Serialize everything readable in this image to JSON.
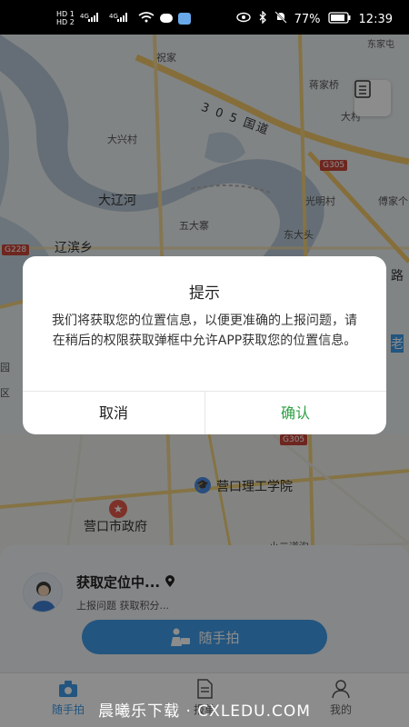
{
  "status_bar": {
    "sim1": "HD 1",
    "sim2": "HD 2",
    "net1": "4G",
    "net2": "4G",
    "battery": "77%",
    "time": "12:39"
  },
  "map": {
    "labels": {
      "zhuangjia": "祝家",
      "road305": "3 0 5 国道",
      "jiangjia": "蒋家桥",
      "daxingcun": "大兴村",
      "dacun": "大村",
      "daliaohe": "大辽河",
      "wudazhai": "五大寨",
      "guangmingcun": "光明村",
      "fujia": "傅家个",
      "dongdatou": "东大头",
      "liaobinxiang": "辽滨乡",
      "yingkou_ligong": "营口理工学院",
      "yingkou_gov": "营口市政府",
      "xiaozhen": "小二道沟",
      "lu": "路",
      "lao": "老",
      "yuan": "园",
      "qu": "区",
      "top_right": "东家屯"
    },
    "shields": {
      "g305_top": "G305",
      "g305_bottom": "G305",
      "g228": "G228"
    },
    "menu_icon": "list-icon"
  },
  "sheet": {
    "location_title": "获取定位中...",
    "location_sub": "上报问题 获取积分...",
    "snap_button": "随手拍",
    "pin_icon": "location-pin-icon"
  },
  "tabs": [
    {
      "label": "随手拍",
      "icon": "camera-icon",
      "active": true
    },
    {
      "label": "报单",
      "icon": "document-icon",
      "active": false
    },
    {
      "label": "我的",
      "icon": "user-icon",
      "active": false
    }
  ],
  "watermark": "晨曦乐下载 · CXLEDU.COM",
  "dialog": {
    "title": "提示",
    "message": "我们将获取您的位置信息，以便更准确的上报问题，请在稍后的权限获取弹框中允许APP获取您的位置信息。",
    "cancel": "取消",
    "confirm": "确认",
    "confirm_color": "#2ea043"
  },
  "colors": {
    "accent": "#3e9be8",
    "river": "#b8c9d8"
  }
}
